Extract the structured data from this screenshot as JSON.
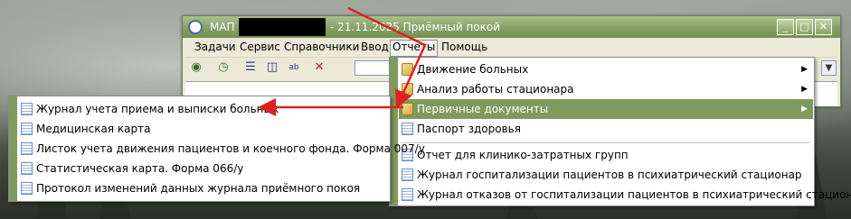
{
  "window": {
    "title_prefix": "МАП",
    "title_rest": "- 21.11.2025 Приёмный покой",
    "buttons": {
      "minimize": "_",
      "maximize": "□",
      "close": "✕"
    }
  },
  "menubar": {
    "items": [
      "Задачи",
      "Сервис",
      "Справочники",
      "Ввод",
      "Отчеты",
      "Помощь"
    ],
    "open_item": "Отчеты"
  },
  "toolbar": {
    "icons": [
      "eye-icon",
      "clock-icon",
      "windows-cascade-icon",
      "panel-icon",
      "text-format-icon",
      "delete-rows-icon"
    ],
    "combo_arrow": "▼"
  },
  "reports_menu": {
    "items": [
      {
        "label": "Движение больных",
        "icon": "folder-icon",
        "submenu": true
      },
      {
        "label": "Анализ работы стационара",
        "icon": "folder-icon",
        "submenu": true
      },
      {
        "label": "Первичные документы",
        "icon": "folder-icon",
        "submenu": true,
        "highlighted": true
      },
      {
        "label": "Паспорт здоровья",
        "icon": "document-icon",
        "submenu": false
      },
      {
        "label": "Отчет для клинико-затратных групп",
        "icon": "document-icon",
        "submenu": false
      },
      {
        "label": "Журнал госпитализации пациентов в психиатрический стационар",
        "icon": "document-icon",
        "submenu": false
      },
      {
        "label": "Журнал отказов от госпитализации пациентов в психиатрический стационар",
        "icon": "document-icon",
        "submenu": false
      }
    ],
    "submenu_arrow": "▶"
  },
  "primary_docs_submenu": {
    "items": [
      {
        "label": "Журнал учета приема и выписки больных",
        "icon": "document-icon"
      },
      {
        "label": "Медицинская карта",
        "icon": "document-icon"
      },
      {
        "label": "Листок учета движения пациентов и коечного фонда. Форма 007/у",
        "icon": "document-icon"
      },
      {
        "label": "Статистическая карта. Форма 066/у",
        "icon": "document-icon"
      },
      {
        "label": "Протокол изменений данных журнала приёмного покоя",
        "icon": "document-icon"
      }
    ]
  },
  "colors": {
    "accent": "#7f9a5c",
    "annotation_arrow": "#e02020"
  }
}
